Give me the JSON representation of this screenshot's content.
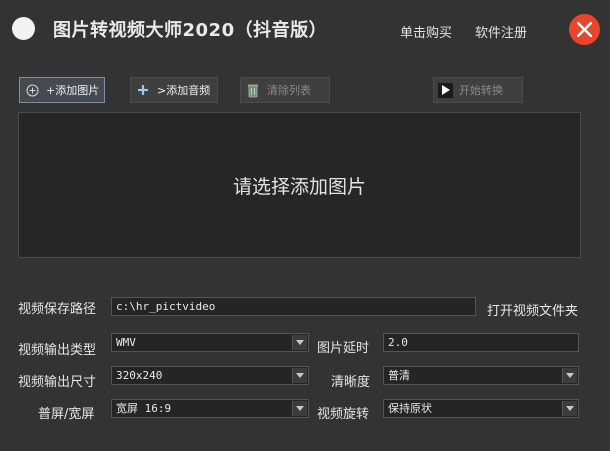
{
  "window": {
    "title": "图片转视频大师2020（抖音版）",
    "buy_label": "单击购买",
    "register_label": "软件注册"
  },
  "toolbar": {
    "add_image_label": "+添加图片",
    "add_audio_label": ">添加音频",
    "clear_list_label": "清除列表",
    "start_convert_label": "开始转换"
  },
  "image_list": {
    "placeholder": "请选择添加图片"
  },
  "form": {
    "save_path_label": "视频保存路径",
    "save_path_value": "c:\\hr_pictvideo",
    "open_folder_label": "打开视频文件夹",
    "output_type_label": "视频输出类型",
    "output_type_value": "WMV",
    "image_delay_label": "图片延时",
    "image_delay_value": "2.0",
    "output_size_label": "视频输出尺寸",
    "output_size_value": "320x240",
    "clarity_label": "清晰度",
    "clarity_value": "普清",
    "aspect_label": "普屏/宽屏",
    "aspect_value": "宽屏 16:9",
    "rotation_label": "视频旋转",
    "rotation_value": "保持原状"
  },
  "colors": {
    "background": "#333333",
    "close_button": "#e8452c",
    "list_background": "#262626"
  }
}
